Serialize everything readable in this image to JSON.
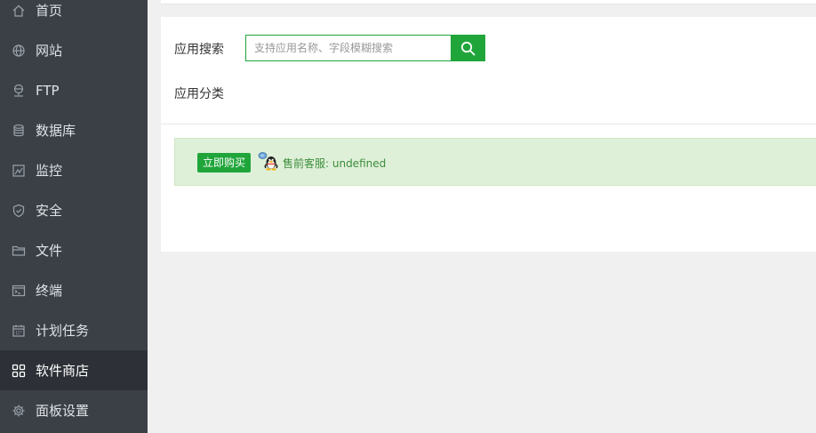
{
  "sidebar": {
    "items": [
      {
        "label": "首页",
        "icon": "home-icon"
      },
      {
        "label": "网站",
        "icon": "globe-icon"
      },
      {
        "label": "FTP",
        "icon": "network-icon"
      },
      {
        "label": "数据库",
        "icon": "database-icon"
      },
      {
        "label": "监控",
        "icon": "monitor-chart-icon"
      },
      {
        "label": "安全",
        "icon": "shield-icon"
      },
      {
        "label": "文件",
        "icon": "folder-icon"
      },
      {
        "label": "终端",
        "icon": "terminal-icon"
      },
      {
        "label": "计划任务",
        "icon": "calendar-icon"
      },
      {
        "label": "软件商店",
        "icon": "grid-apps-icon",
        "active": true
      },
      {
        "label": "面板设置",
        "icon": "gear-icon"
      }
    ]
  },
  "search": {
    "label": "应用搜索",
    "placeholder": "支持应用名称、字段模糊搜索",
    "value": ""
  },
  "category": {
    "label": "应用分类"
  },
  "notice": {
    "buy_label": "立即购买",
    "presale_text": "售前客服: undefined"
  },
  "colors": {
    "sidebar_bg": "#3b4047",
    "sidebar_active_bg": "#2d3137",
    "accent": "#20a53a",
    "notice_bg": "#dff0d8",
    "notice_text": "#3c8d3c"
  }
}
